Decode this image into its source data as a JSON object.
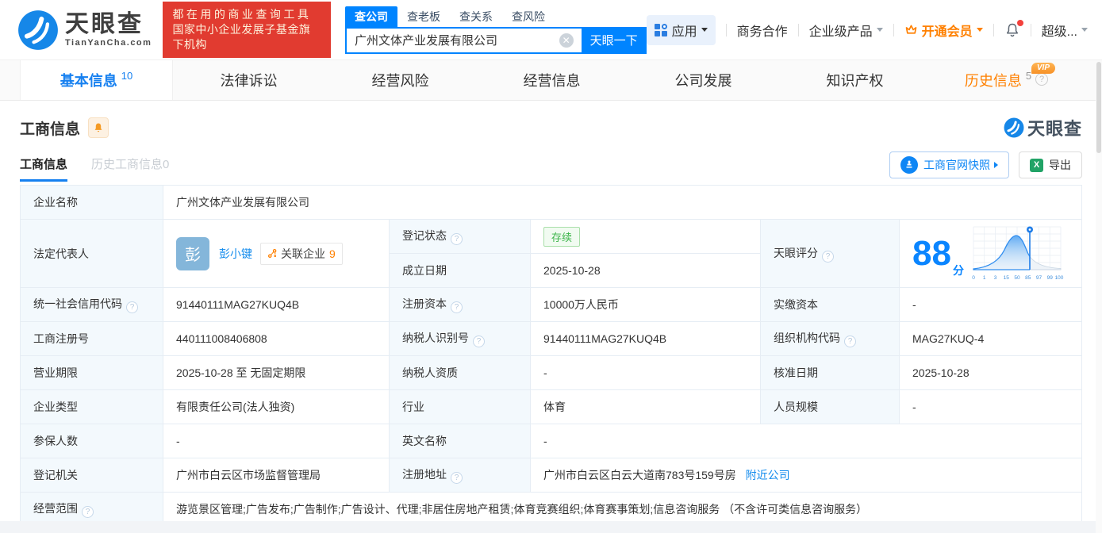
{
  "colors": {
    "accent": "#0084ff",
    "orange": "#ff8000",
    "green": "#3cb54a",
    "promo_red": "#e13b30"
  },
  "header": {
    "brand": "天眼查",
    "brand_domain": "TianYanCha.com",
    "promo_line1": "都在用的商业查询工具",
    "promo_line2": "国家中小企业发展子基金旗下机构",
    "search_tabs": {
      "t0": "查公司",
      "t1": "查老板",
      "t2": "查关系",
      "t3": "查风险"
    },
    "search_value": "广州文体产业发展有限公司",
    "search_button": "天眼一下",
    "nav_apps": "应用",
    "nav_business": "商务合作",
    "nav_enterprise": "企业级产品",
    "nav_vip": "开通会员",
    "nav_user": "超级..."
  },
  "tabs": {
    "basic": "基本信息",
    "basic_count": "10",
    "legal": "法律诉讼",
    "risk": "经营风险",
    "operation": "经营信息",
    "development": "公司发展",
    "ip": "知识产权",
    "history": "历史信息",
    "history_count": "5",
    "history_vip": "VIP"
  },
  "section": {
    "title": "工商信息",
    "subtab_active": "工商信息",
    "subtab_history": "历史工商信息0",
    "watermark": "天眼查",
    "snapshot_button": "工商官网快照",
    "export_button": "导出"
  },
  "info": {
    "company_name_label": "企业名称",
    "company_name": "广州文体产业发展有限公司",
    "legal_rep_label": "法定代表人",
    "legal_rep_avatar": "彭",
    "legal_rep_name": "彭小键",
    "related_label": "关联企业",
    "related_count": "9",
    "reg_status_label": "登记状态",
    "reg_status": "存续",
    "establish_label": "成立日期",
    "establish_date": "2025-10-28",
    "score_label": "天眼评分",
    "score": "88",
    "score_unit": "分",
    "credit_code_label": "统一社会信用代码",
    "credit_code": "91440111MAG27KUQ4B",
    "reg_capital_label": "注册资本",
    "reg_capital": "10000万人民币",
    "paid_capital_label": "实缴资本",
    "paid_capital": "-",
    "reg_number_label": "工商注册号",
    "reg_number": "440111008406808",
    "taxpayer_id_label": "纳税人识别号",
    "taxpayer_id": "91440111MAG27KUQ4B",
    "org_code_label": "组织机构代码",
    "org_code": "MAG27KUQ-4",
    "business_term_label": "营业期限",
    "business_term": "2025-10-28 至 无固定期限",
    "taxpayer_quality_label": "纳税人资质",
    "taxpayer_quality": "-",
    "approval_date_label": "核准日期",
    "approval_date": "2025-10-28",
    "company_type_label": "企业类型",
    "company_type": "有限责任公司(法人独资)",
    "industry_label": "行业",
    "industry": "体育",
    "staff_size_label": "人员规模",
    "staff_size": "-",
    "insured_label": "参保人数",
    "insured": "-",
    "english_name_label": "英文名称",
    "english_name": "-",
    "reg_authority_label": "登记机关",
    "reg_authority": "广州市白云区市场监督管理局",
    "reg_address_label": "注册地址",
    "reg_address": "广州市白云区白云大道南783号159号房",
    "nearby_link": "附近公司",
    "business_scope_label": "经营范围",
    "business_scope": "游览景区管理;广告发布;广告制作;广告设计、代理;非居住房地产租赁;体育竞赛组织;体育赛事策划;信息咨询服务 （不含许可类信息咨询服务）"
  },
  "chart_data": {
    "type": "area",
    "title": "天眼评分分布曲线",
    "score": 88,
    "marker_value": 88,
    "x_ticks": [
      "0",
      "1",
      "3",
      "15",
      "50",
      "85",
      "97",
      "99",
      "100"
    ],
    "curve_shape": "bell curve peaking near tick 50, blue filled left of marker at 88, gray tail right",
    "legend": "none",
    "grid": "on"
  }
}
